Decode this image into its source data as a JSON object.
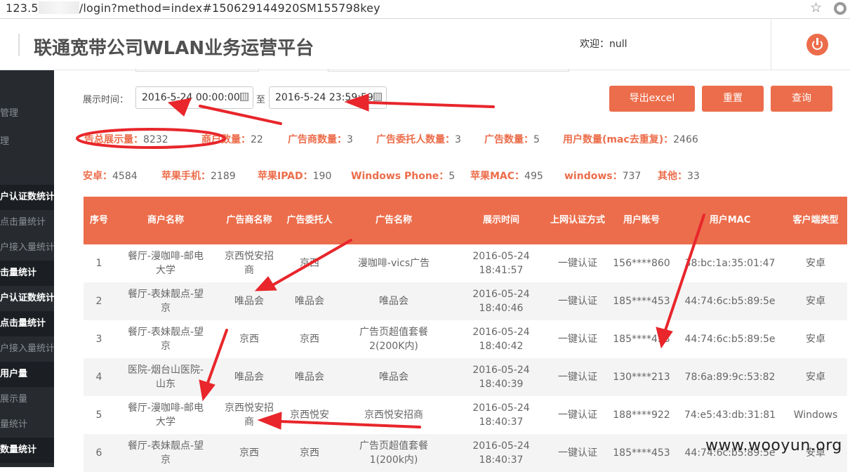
{
  "browser": {
    "url_prefix": "123.5",
    "url_suffix": "/login?method=index#150629144920SM155798key"
  },
  "header": {
    "title": "联通宽带公司WLAN业务运营平台",
    "welcome": "欢迎：null"
  },
  "sidebar": {
    "items": [
      "管理",
      "理",
      "户认证数统计",
      "点击量统计",
      "户接入量统计",
      "击量统计",
      "户认证数统计",
      "点击量统计",
      "户接入量统计",
      "用户量",
      "展示量",
      "量统计",
      "数量统计"
    ]
  },
  "filter": {
    "date_label": "展示时间：",
    "start": "2016-5-24 00:00:00",
    "to": "至",
    "end": "2016-5-24 23:59:59",
    "export_label": "导出excel",
    "reset_label": "重置",
    "query_label": "查询"
  },
  "stats1": [
    {
      "k": "告总展示量：",
      "v": "8232"
    },
    {
      "k": "商户数量：",
      "v": "22"
    },
    {
      "k": "广告商数量：",
      "v": "3"
    },
    {
      "k": "广告委托人数量：",
      "v": "3"
    },
    {
      "k": "广告数量：",
      "v": "5"
    },
    {
      "k": "用户数量(mac去重复)：",
      "v": "2466"
    }
  ],
  "stats2": [
    {
      "k": "安卓：",
      "v": "4584"
    },
    {
      "k": "苹果手机：",
      "v": "2189"
    },
    {
      "k": "苹果IPAD：",
      "v": "190"
    },
    {
      "k": "Windows Phone：",
      "v": "5"
    },
    {
      "k": "苹果MAC：",
      "v": "495"
    },
    {
      "k": "windows：",
      "v": "737"
    },
    {
      "k": "其他：",
      "v": "33"
    }
  ],
  "table": {
    "headers": [
      "序号",
      "商户名称",
      "广告商名称",
      "广告委托人",
      "广告名称",
      "展示时间",
      "上网认证方式",
      "用户账号",
      "用户MAC",
      "客户端类型"
    ],
    "rows": [
      [
        "1",
        "餐厅-漫咖啡-邮电大学",
        "京西悦安招商",
        "京西",
        "漫咖啡-vics广告",
        "2016-05-24 18:41:57",
        "一键认证",
        "156****860",
        "38:bc:1a:35:01:47",
        "安卓"
      ],
      [
        "2",
        "餐厅-表妹靓点-望京",
        "唯品会",
        "唯品会",
        "唯品会",
        "2016-05-24 18:40:46",
        "一键认证",
        "185****453",
        "44:74:6c:b5:89:5e",
        "安卓"
      ],
      [
        "3",
        "餐厅-表妹靓点-望京",
        "京西",
        "京西",
        "广告页超值套餐2(200K内)",
        "2016-05-24 18:40:42",
        "一键认证",
        "185****453",
        "44:74:6c:b5:89:5e",
        "安卓"
      ],
      [
        "4",
        "医院-烟台山医院-山东",
        "唯品会",
        "唯品会",
        "唯品会",
        "2016-05-24 18:40:39",
        "一键认证",
        "130****213",
        "78:6a:89:9c:53:82",
        "安卓"
      ],
      [
        "5",
        "餐厅-漫咖啡-邮电大学",
        "京西悦安招商",
        "京西悦安",
        "京西悦安招商",
        "2016-05-24 18:40:37",
        "一键认证",
        "188****922",
        "74:e5:43:db:31:81",
        "Windows"
      ],
      [
        "6",
        "餐厅-表妹靓点-望京",
        "京西",
        "京西",
        "广告页超值套餐1(200k内)",
        "2016-05-24 18:40:37",
        "一键认证",
        "185****453",
        "44:74:6c:b5:89:5e",
        "安卓"
      ]
    ]
  },
  "watermark": "www.wooyun.org",
  "colors": {
    "accent": "#ec6d4b",
    "sidebar": "#272b30",
    "annotation": "#e8262b"
  }
}
